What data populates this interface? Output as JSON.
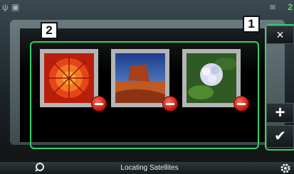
{
  "status": {
    "usb_icon": "usb-icon",
    "wifi_icon": "wifi-icon",
    "right_value": "2"
  },
  "callouts": {
    "one": "1",
    "two": "2"
  },
  "side_buttons": {
    "close": "×",
    "add": "+",
    "confirm": "✔"
  },
  "bottom_bar": {
    "message": "Locating Satellites",
    "left_icon": "navigation-icon",
    "right_icon": "settings-icon"
  },
  "thumbnails": [
    {
      "name": "red flower"
    },
    {
      "name": "desert butte"
    },
    {
      "name": "white flower"
    }
  ],
  "colors": {
    "highlight": "#30d26a",
    "remove": "#d42a1a"
  }
}
